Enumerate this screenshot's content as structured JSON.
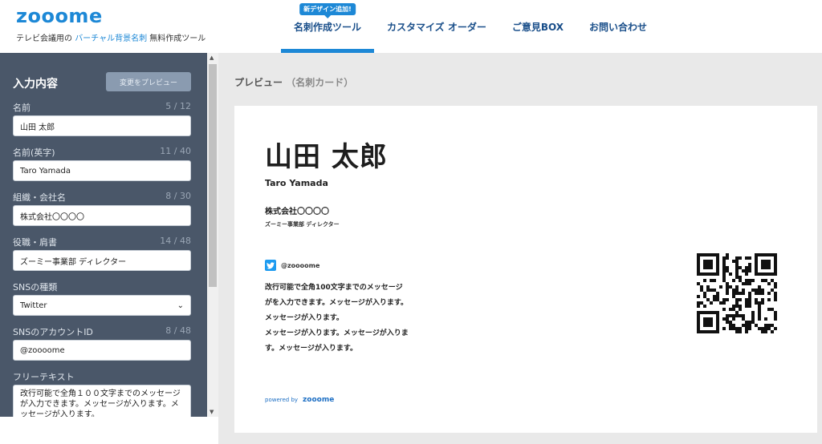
{
  "header": {
    "logo": "zooome",
    "tagline_prefix": "テレビ会議用の",
    "tagline_accent": "バーチャル背景名刺",
    "tagline_suffix": "無料作成ツール",
    "nav": [
      {
        "label": "名刺作成ツール",
        "badge": "新デザイン追加!",
        "active": true
      },
      {
        "label": "カスタマイズ オーダー"
      },
      {
        "label": "ご意見BOX"
      },
      {
        "label": "お問い合わせ"
      }
    ]
  },
  "sidebar": {
    "title": "入力内容",
    "preview_button": "変更をプレビュー",
    "fields": [
      {
        "label": "名前",
        "count": "5 / 12",
        "value": "山田 太郎"
      },
      {
        "label": "名前(英字)",
        "count": "11 / 40",
        "value": "Taro Yamada"
      },
      {
        "label": "組織・会社名",
        "count": "8 / 30",
        "value": "株式会社〇〇〇〇"
      },
      {
        "label": "役職・肩書",
        "count": "14 / 48",
        "value": "ズーミー事業部 ディレクター"
      },
      {
        "label": "SNSの種類",
        "value": "Twitter"
      },
      {
        "label": "SNSのアカウントID",
        "count": "8 / 48",
        "value": "@zoooome"
      },
      {
        "label": "フリーテキスト",
        "value": "改行可能で全角１００文字までのメッセージが入力できます。メッセージが入ります。メッセージが入ります。"
      }
    ]
  },
  "preview": {
    "heading": "プレビュー",
    "heading_sub": "（名刺カード）",
    "card": {
      "name": "山田 太郎",
      "name_en": "Taro Yamada",
      "org": "株式会社〇〇〇〇",
      "role": "ズーミー事業部 ディレクター",
      "sns_id": "@zoooome",
      "text_lines": [
        "改行可能で全角100文字までのメッセージ",
        "がを入力できます。メッセージが入ります。",
        "メッセージが入ります。",
        "メッセージが入ります。メッセージが入りま",
        "す。メッセージが入ります。"
      ],
      "powered_by": "powered by",
      "brand": "zooome"
    }
  },
  "colors": {
    "accent": "#1d88d6",
    "sidebar_bg": "#4a5769",
    "twitter": "#1d9bf0"
  }
}
